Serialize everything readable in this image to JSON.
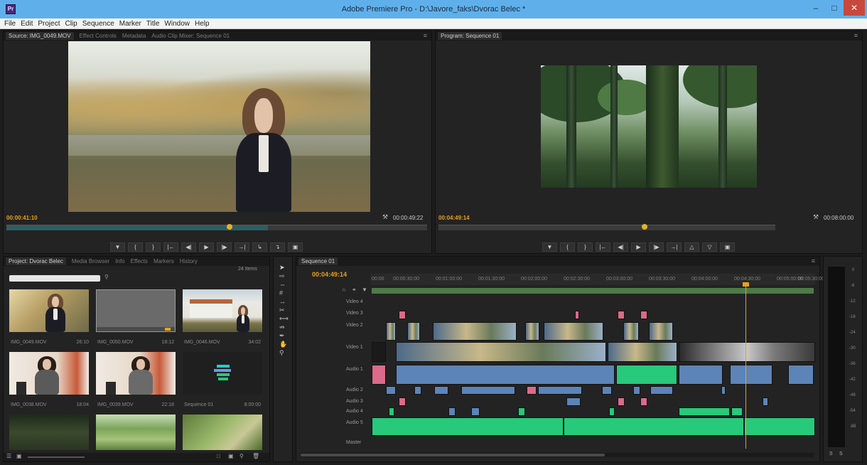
{
  "window": {
    "app_icon": "Pr",
    "title": "Adobe Premiere Pro - D:\\Javore_faks\\Dvorac Belec *",
    "min_icon": "minimize-icon",
    "max_icon": "maximize-icon",
    "close_icon": "close-icon"
  },
  "menu": [
    "File",
    "Edit",
    "Project",
    "Clip",
    "Sequence",
    "Marker",
    "Title",
    "Window",
    "Help"
  ],
  "source_monitor": {
    "tabs": [
      "Source: IMG_0049.MOV",
      "Effect Controls",
      "Metadata",
      "Audio Clip Mixer: Sequence 01"
    ],
    "timecode_in": "00:00:41:10",
    "timecode_out": "00:00:49:22",
    "playhead_fraction": 0.52
  },
  "program_monitor": {
    "tabs": [
      "Program: Sequence 01"
    ],
    "timecode_in": "00:04:49:14",
    "timecode_out": "00:08:00:00",
    "playhead_fraction": 0.61
  },
  "transport_icons": [
    "marker-icon",
    "mark-in-icon",
    "mark-out-icon",
    "go-to-in-icon",
    "step-back-icon",
    "play-icon",
    "step-forward-icon",
    "go-to-out-icon",
    "insert-icon",
    "overwrite-icon",
    "export-frame-icon"
  ],
  "project_panel": {
    "tabs": [
      "Project: Dvorac Belec",
      "Media Browser",
      "Info",
      "Effects",
      "Markers",
      "History"
    ],
    "search_placeholder": "",
    "items_count": "24 Items",
    "items": [
      {
        "name": "IMG_0049.MOV",
        "duration": "26:10"
      },
      {
        "name": "IMG_0050.MOV",
        "duration": "18:12"
      },
      {
        "name": "IMG_0046.MOV",
        "duration": "34:02"
      },
      {
        "name": "IMG_0038.MOV",
        "duration": "18:04"
      },
      {
        "name": "IMG_0039.MOV",
        "duration": "22:18"
      },
      {
        "name": "Sequence 01",
        "duration": "8:00:00"
      },
      {
        "name": "",
        "duration": ""
      },
      {
        "name": "",
        "duration": ""
      },
      {
        "name": "",
        "duration": ""
      }
    ]
  },
  "timeline": {
    "tabs": [
      "Sequence 01"
    ],
    "timecode": "00:04:49:14",
    "ruler": [
      "00:00",
      "00:00:30:00",
      "00:01:00:00",
      "00:01:30:00",
      "00:02:00:00",
      "00:02:30:00",
      "00:03:00:00",
      "00:03:30:00",
      "00:04:00:00",
      "00:04:30:00",
      "00:05:00:00",
      "00:05:30:00"
    ],
    "video_tracks": [
      "Video 4",
      "Video 3",
      "Video 2",
      "Video 1"
    ],
    "audio_tracks": [
      "Audio 1",
      "Audio 2",
      "Audio 3",
      "Audio 4",
      "Audio 5"
    ],
    "master": "Master"
  },
  "audio_meter": {
    "scale": [
      "0",
      "-6",
      "-12",
      "-18",
      "-24",
      "-30",
      "-36",
      "-42",
      "-48",
      "-54",
      "dB"
    ]
  },
  "colors": {
    "accent_timecode": "#e8a21a",
    "clip_video": "#7da0c8",
    "clip_audio_green": "#27c97a",
    "clip_pink": "#dc6a8a"
  }
}
